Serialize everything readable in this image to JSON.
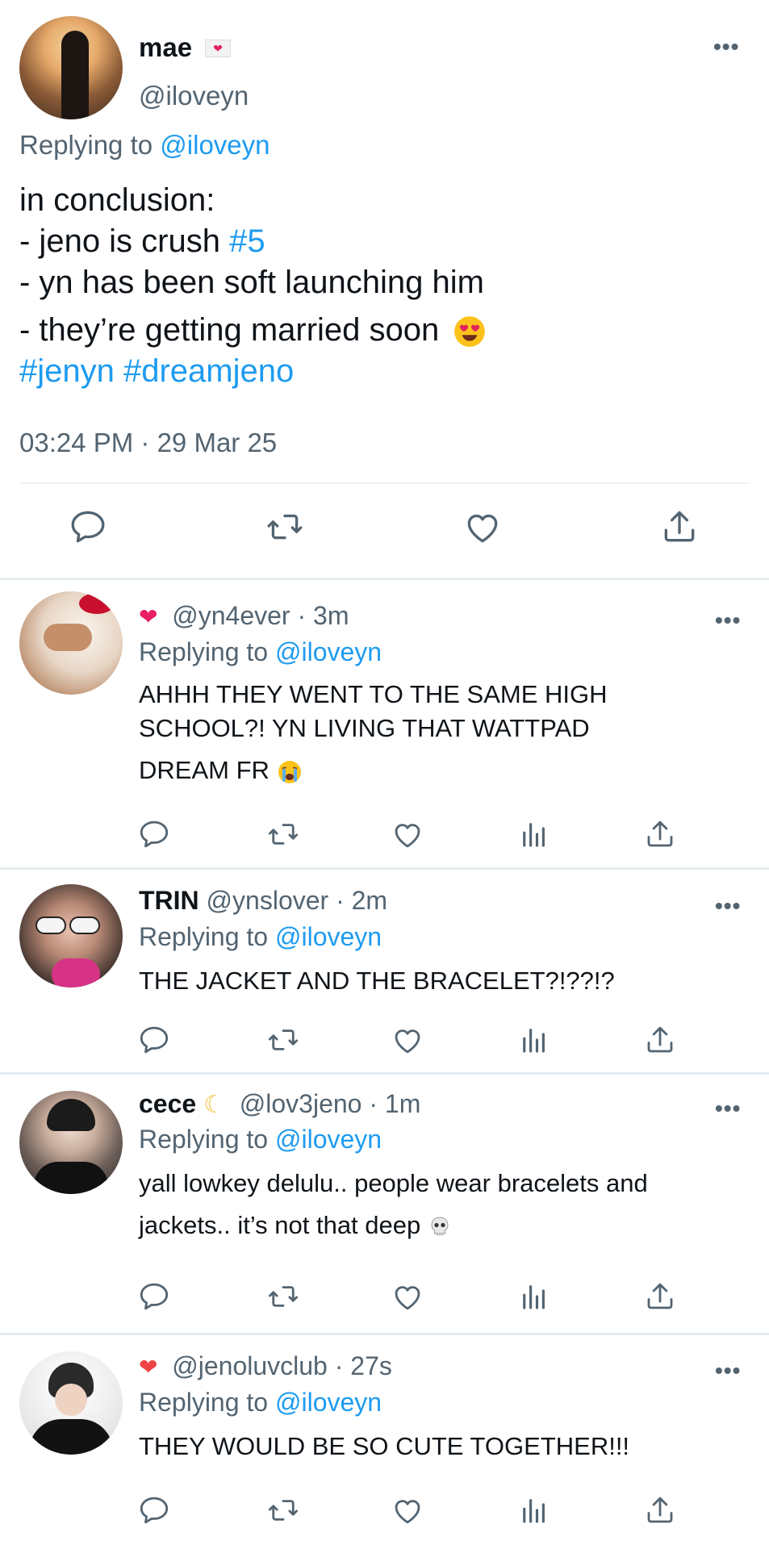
{
  "main": {
    "name": "mae",
    "name_badge_icon": "envelope-heart-icon",
    "handle": "@iloveyn",
    "replying_prefix": "Replying to",
    "replying_handle": "@iloveyn",
    "body": {
      "line1": "in conclusion:",
      "line2_text": "- jeno is crush",
      "line2_tag": "#5",
      "line3": "- yn has been soft launching him",
      "line4": "- they’re getting married soon",
      "line4_emoji": "heart-eyes-emoji",
      "tags": "#jenyn #dreamjeno"
    },
    "timestamp": "03:24 PM · 29 Mar 25",
    "more": "•••",
    "actions": [
      "reply-icon",
      "retweet-icon",
      "like-icon",
      "share-icon"
    ]
  },
  "replies": [
    {
      "name": "",
      "name_icon": "heart-arrow-emoji",
      "handle": "@yn4ever",
      "time": "· 3m",
      "replying_prefix": "Replying to",
      "replying_handle": "@iloveyn",
      "body_line1": "AHHH THEY WENT TO THE SAME HIGH",
      "body_line2": "SCHOOL?! YN LIVING THAT WATTPAD",
      "body_line3": "DREAM FR",
      "body_emoji": "crying-face-emoji",
      "more": "•••"
    },
    {
      "name": "TRIN",
      "handle": "@ynslover",
      "time": "· 2m",
      "replying_prefix": "Replying to",
      "replying_handle": "@iloveyn",
      "body_line1": "THE JACKET AND THE BRACELET?!??!?",
      "more": "•••"
    },
    {
      "name": "cece",
      "name_icon": "crescent-moon-emoji",
      "handle": "@lov3jeno",
      "time": "· 1m",
      "replying_prefix": "Replying to",
      "replying_handle": "@iloveyn",
      "body_line1": "yall lowkey delulu.. people wear bracelets and",
      "body_line2": "jackets.. it’s not that deep",
      "body_emoji": "skull-emoji",
      "more": "•••"
    },
    {
      "name": "",
      "name_icon": "burning-heart-emoji",
      "handle": "@jenoluvclub",
      "time": "· 27s",
      "replying_prefix": "Replying to",
      "replying_handle": "@iloveyn",
      "body_line1": "THEY WOULD BE SO CUTE TOGETHER!!!",
      "more": "•••"
    }
  ],
  "reply_actions": [
    "reply-icon",
    "retweet-icon",
    "like-icon",
    "views-icon",
    "share-icon"
  ],
  "colors": {
    "link": "#1d9bf0",
    "secondary_text": "#536471",
    "primary_text": "#0f1419",
    "divider": "#e6ecf0"
  }
}
